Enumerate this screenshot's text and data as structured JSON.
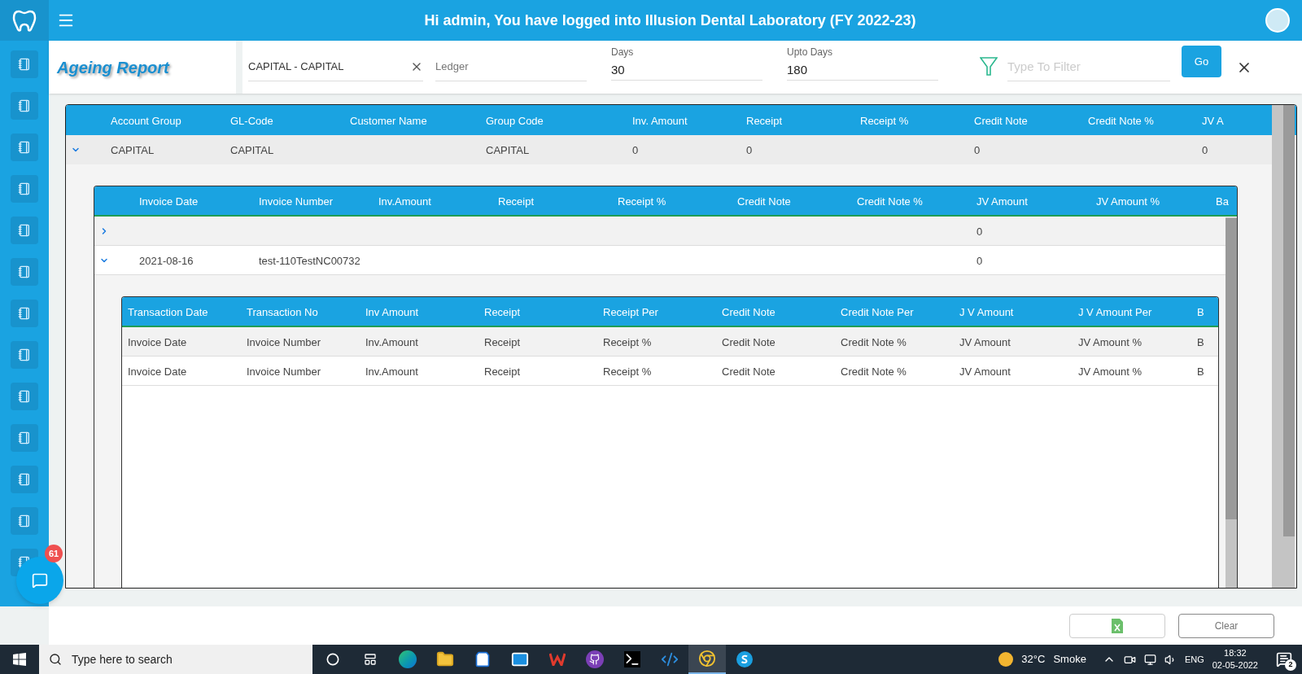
{
  "header": {
    "title": "Hi admin, You have logged into Illusion Dental Laboratory (FY 2022-23)"
  },
  "page_title": "Ageing Report",
  "filters": {
    "ledger_group": {
      "value": "CAPITAL - CAPITAL"
    },
    "ledger": {
      "placeholder": "Ledger"
    },
    "days": {
      "label": "Days",
      "value": "30"
    },
    "upto_days": {
      "label": "Upto Days",
      "value": "180"
    },
    "filter": {
      "placeholder": "Type To Filter"
    },
    "go_button": "Go"
  },
  "table": {
    "columns": [
      "Account Group",
      "GL-Code",
      "Customer Name",
      "Group Code",
      "Inv. Amount",
      "Receipt",
      "Receipt %",
      "Credit Note",
      "Credit Note %",
      "JV A"
    ],
    "rows": [
      {
        "expanded": true,
        "cells": [
          "CAPITAL",
          "CAPITAL",
          null,
          "CAPITAL",
          "0",
          "0",
          null,
          "0",
          null,
          "0"
        ],
        "invoices": {
          "columns": [
            "Invoice Date",
            "Invoice Number",
            "Inv.Amount",
            "Receipt",
            "Receipt %",
            "Credit Note",
            "Credit Note %",
            "JV Amount",
            "JV Amount %",
            "Ba"
          ],
          "rows": [
            {
              "expanded": false,
              "cells": [
                null,
                null,
                null,
                null,
                null,
                null,
                null,
                "0",
                null,
                null
              ]
            },
            {
              "expanded": true,
              "cells": [
                "2021-08-16",
                "test-110TestNC00732",
                null,
                null,
                null,
                null,
                null,
                "0",
                null,
                null
              ],
              "transactions": {
                "columns": [
                  "Transaction Date",
                  "Transaction No",
                  "Inv Amount",
                  "Receipt",
                  "Receipt Per",
                  "Credit Note",
                  "Credit Note Per",
                  "J V Amount",
                  "J V Amount Per",
                  "B"
                ],
                "rows": [
                  [
                    "Invoice Date",
                    "Invoice Number",
                    "Inv.Amount",
                    "Receipt",
                    "Receipt %",
                    "Credit Note",
                    "Credit Note %",
                    "JV Amount",
                    "JV Amount %",
                    "B"
                  ],
                  [
                    "Invoice Date",
                    "Invoice Number",
                    "Inv.Amount",
                    "Receipt",
                    "Receipt %",
                    "Credit Note",
                    "Credit Note %",
                    "JV Amount",
                    "JV Amount %",
                    "B"
                  ]
                ]
              }
            }
          ]
        }
      }
    ]
  },
  "footer": {
    "clear_button": "Clear"
  },
  "chat": {
    "badge": "61"
  },
  "taskbar": {
    "search_placeholder": "Type here to search",
    "temperature": "32°C",
    "weather": "Smoke",
    "language": "ENG",
    "time": "18:32",
    "date": "02-05-2022",
    "notifications": "2"
  }
}
